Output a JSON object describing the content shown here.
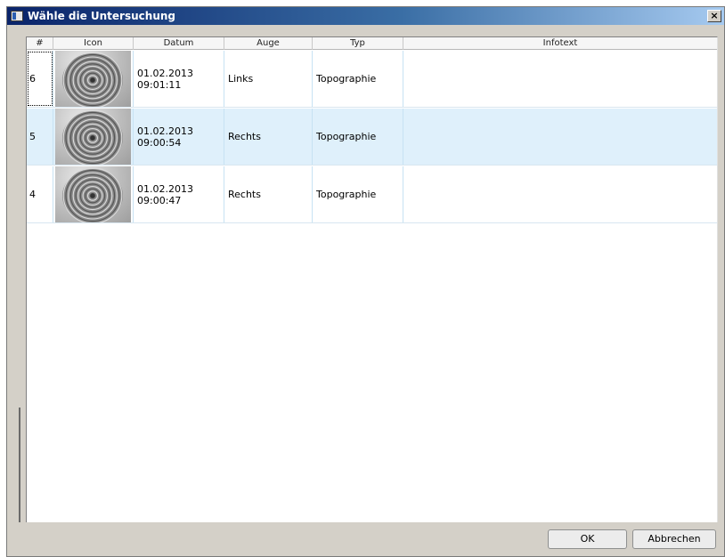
{
  "window": {
    "title": "Wähle die Untersuchung",
    "close_label": "×"
  },
  "table": {
    "columns": [
      "#",
      "Icon",
      "Datum",
      "Auge",
      "Typ",
      "Infotext"
    ],
    "rows": [
      {
        "num": "6",
        "date": "01.02.2013",
        "time": "09:01:11",
        "eye": "Links",
        "type": "Topographie",
        "info": "",
        "selected": false,
        "focused": true
      },
      {
        "num": "5",
        "date": "01.02.2013",
        "time": "09:00:54",
        "eye": "Rechts",
        "type": "Topographie",
        "info": "",
        "selected": true,
        "focused": false
      },
      {
        "num": "4",
        "date": "01.02.2013",
        "time": "09:00:47",
        "eye": "Rechts",
        "type": "Topographie",
        "info": "",
        "selected": false,
        "focused": false
      }
    ]
  },
  "buttons": {
    "ok": "OK",
    "cancel": "Abbrechen"
  },
  "colors": {
    "selected_row": "#dff0fb",
    "title_bar_start": "#0a246a",
    "title_bar_end": "#a6caf0"
  }
}
